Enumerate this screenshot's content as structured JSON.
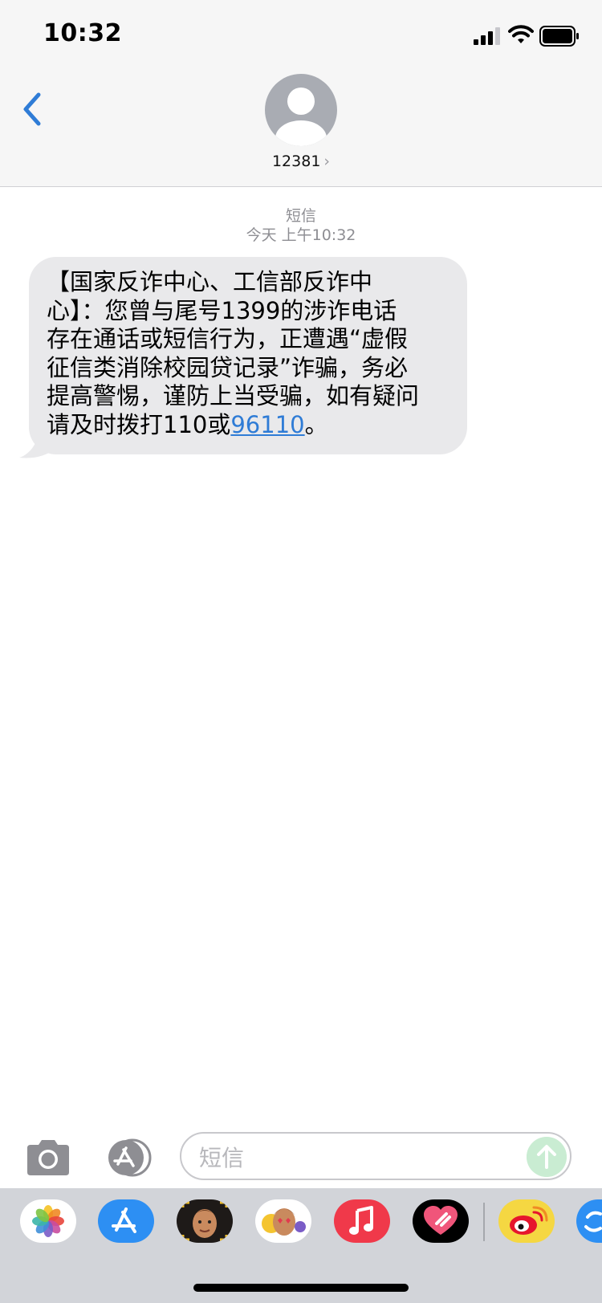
{
  "status_bar": {
    "time": "10:32"
  },
  "header": {
    "contact": "12381",
    "chevron": "›"
  },
  "thread": {
    "service": "短信",
    "timestamp": "今天 上午10:32"
  },
  "message": {
    "lines": [
      "【国家反诈中心、工信部反诈中",
      "心】：您曾与尾号1399的涉诈电话",
      "存在通话或短信行为，正遭遇“虚假",
      "征信类消除校园贷记录”诈骗，务必",
      "提高警惕，谨防上当受骗，如有疑问",
      "请及时拨打110或"
    ],
    "link": "96110",
    "end": "。"
  },
  "composer": {
    "placeholder": "短信"
  },
  "app_strip": {
    "apps": [
      "photos-app-icon",
      "app-store-icon",
      "memoji-icon",
      "animoji-stickers-icon",
      "music-icon",
      "digital-touch-icon",
      "weibo-icon",
      "partial-app-icon"
    ]
  },
  "colors": {
    "accent": "#2f7cd6",
    "bubble": "#e9e9eb",
    "send": "#c9ecd2"
  }
}
